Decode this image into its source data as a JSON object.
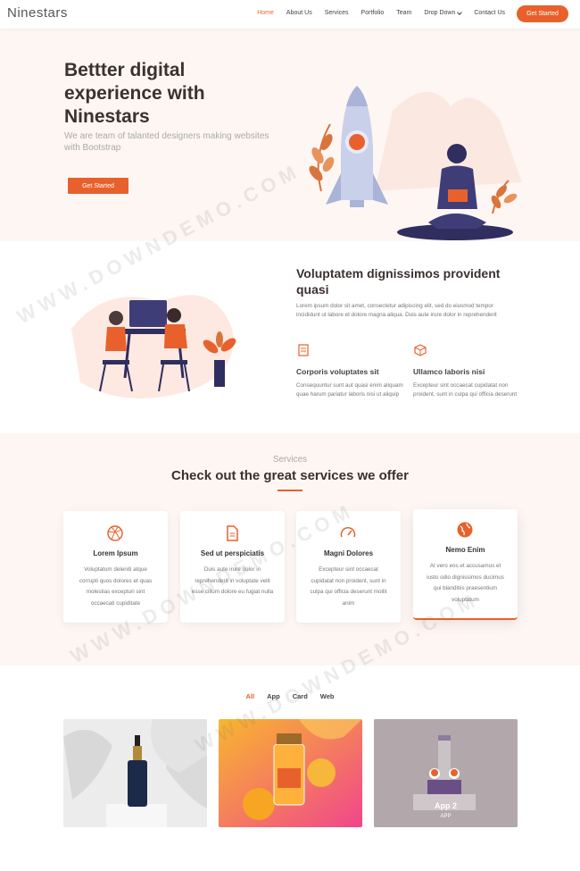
{
  "header": {
    "logo": "Ninestars",
    "nav": [
      {
        "label": "Home",
        "active": true
      },
      {
        "label": "About Us"
      },
      {
        "label": "Services"
      },
      {
        "label": "Portfolio"
      },
      {
        "label": "Team"
      },
      {
        "label": "Drop Down",
        "dropdown": true
      },
      {
        "label": "Contact Us"
      }
    ],
    "cta": "Get Started"
  },
  "hero": {
    "title": "Bettter digital experience with Ninestars",
    "subtitle": "We are team of talanted designers making websites with Bootstrap",
    "button": "Get Started"
  },
  "about": {
    "title": "Voluptatem dignissimos provident quasi",
    "text": "Lorem ipsum dolor sit amet, consectetur adipiscing elit, sed do eiusmod tempor incididunt ut labore et dolore magna aliqua. Duis aute irure dolor in reprehenderit",
    "features": [
      {
        "title": "Corporis voluptates sit",
        "text": "Consequuntur sunt aut quasi enim aliquam quae harum pariatur laboris nisi ut aliquip"
      },
      {
        "title": "Ullamco laboris nisi",
        "text": "Excepteur sint occaecat cupidatat non proident, sunt in culpa qui officia deserunt"
      }
    ]
  },
  "services": {
    "kicker": "Services",
    "title": "Check out the great services we offer",
    "items": [
      {
        "icon": "dribbble-icon",
        "title": "Lorem Ipsum",
        "text": "Voluptatum deleniti atque corrupti quos dolores et quas molestias excepturi sint occaecati cupiditate"
      },
      {
        "icon": "file-icon",
        "title": "Sed ut perspiciatis",
        "text": "Duis aute irure dolor in reprehenderit in voluptate velit esse cillum dolore eu fugiat nulla"
      },
      {
        "icon": "speedometer-icon",
        "title": "Magni Dolores",
        "text": "Excepteur sint occaecat cupidatat non proident, sunt in culpa qui officia deserunt mollit anim"
      },
      {
        "icon": "globe-icon",
        "title": "Nemo Enim",
        "text": "At vero eos et accusamus et iusto odio dignissimos ducimus qui blanditiis praesentium voluptatum"
      }
    ]
  },
  "portfolio": {
    "filters": [
      "All",
      "App",
      "Card",
      "Web"
    ],
    "active_filter": "All",
    "items": [
      {
        "title": "",
        "category": ""
      },
      {
        "title": "",
        "category": ""
      },
      {
        "title": "App 2",
        "category": "APP"
      }
    ]
  },
  "watermark": "WWW.DOWNDEMO.COM",
  "colors": {
    "accent": "#e8612c",
    "hero_bg": "#fdf6f3",
    "heading": "#3c3030"
  }
}
